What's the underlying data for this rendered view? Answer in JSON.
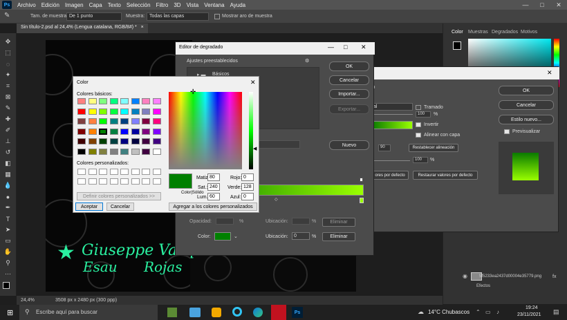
{
  "menubar": {
    "items": [
      "Archivo",
      "Edición",
      "Imagen",
      "Capa",
      "Texto",
      "Selección",
      "Filtro",
      "3D",
      "Vista",
      "Ventana",
      "Ayuda"
    ],
    "app_logo": "Ps"
  },
  "window_controls": {
    "minimize": "—",
    "maximize": "□",
    "close": "✕"
  },
  "optionsbar": {
    "sample_size_label": "Tam. de muestra:",
    "sample_size_value": "De 1 punto",
    "sample_label": "Muestra:",
    "sample_value": "Todas las capas",
    "show_ring_label": "Mostrar aro de muestra"
  },
  "document": {
    "tab": "Sin título-2.psd al 24,4% (Lengua catalana, RGB/8#) *",
    "tab_close": "×"
  },
  "status": {
    "zoom": "24,4%",
    "size": "3508 px x 2480 px (300 ppp)"
  },
  "canvas_text": {
    "line1": "Giuseppe Vasqu",
    "line2": "Esau",
    "line3": "Rojas",
    "star": "★"
  },
  "right_panel": {
    "tabs": [
      "Color",
      "Muestras",
      "Degradados",
      "Motivos"
    ],
    "layer_name": "5f5233ea2437d00004e35779.png",
    "effects_label": "Efectos",
    "fx": "fx"
  },
  "gradient_editor": {
    "title": "Editor de degradado",
    "presets_label": "Ajustes preestablecidos",
    "folder_label": "Básicos",
    "buttons": {
      "ok": "OK",
      "cancel": "Cancelar",
      "import": "Importar...",
      "export": "Exportar...",
      "new": "Nuevo"
    },
    "opacity_label": "Opacidad:",
    "location_label": "Ubicación:",
    "delete_label": "Eliminar",
    "color_label": "Color:",
    "color_location_value": "0",
    "percent": "%",
    "gradient_color_start": "#0a7a00",
    "gradient_color_end": "#9aff00"
  },
  "layer_style": {
    "buttons": {
      "ok": "OK",
      "cancel": "Cancelar",
      "new_style": "Estilo nuevo...",
      "reset_align": "Restablecer alineación",
      "restore_default": "Restaurar valores por defecto",
      "default": "ores por defecto"
    },
    "preview_label": "Previsualizar",
    "dither_label": "Tramado",
    "reverse_label": "Invertir",
    "align_label": "Alinear con capa",
    "opacity_value": "100",
    "angle_value": "90",
    "scale_value": "100",
    "percent": "%",
    "section_frag": "lo",
    "mode_frag": "al"
  },
  "color_dialog": {
    "title": "Color",
    "basic_colors_label": "Colores básicos:",
    "custom_colors_label": "Colores personalizados:",
    "define_button": "Definir colores personalizados >>",
    "accept_button": "Aceptar",
    "cancel_button": "Cancelar",
    "add_button": "Agregar a los colores personalizados",
    "color_solid_label": "Color|Sólido",
    "hue_label": "Matiz:",
    "hue_value": "80",
    "sat_label": "Sat.:",
    "sat_value": "240",
    "lum_label": "Lum.:",
    "lum_value": "60",
    "red_label": "Rojo:",
    "red_value": "0",
    "green_label": "Verde:",
    "green_value": "128",
    "blue_label": "Azul:",
    "blue_value": "0",
    "selected_color": "#008000",
    "basic_colors": [
      "#ff8080",
      "#ffff80",
      "#80ff80",
      "#00ff80",
      "#80ffff",
      "#0080ff",
      "#ff80c0",
      "#ff80ff",
      "#ff0000",
      "#ffff00",
      "#80ff00",
      "#00ff40",
      "#00ffff",
      "#0080c0",
      "#8080c0",
      "#ff00ff",
      "#804040",
      "#ff8040",
      "#00ff00",
      "#008080",
      "#004080",
      "#8080ff",
      "#800040",
      "#ff0080",
      "#800000",
      "#ff8000",
      "#008000",
      "#008040",
      "#0000ff",
      "#0000a0",
      "#800080",
      "#8000ff",
      "#400000",
      "#804000",
      "#004000",
      "#004040",
      "#000080",
      "#000040",
      "#400040",
      "#400080",
      "#000000",
      "#808000",
      "#808040",
      "#808080",
      "#408080",
      "#c0c0c0",
      "#400040",
      "#ffffff"
    ]
  },
  "taskbar": {
    "search_placeholder": "Escribe aquí para buscar",
    "weather": "14°C  Chubascos",
    "time": "19:24",
    "date": "23/11/2021"
  }
}
